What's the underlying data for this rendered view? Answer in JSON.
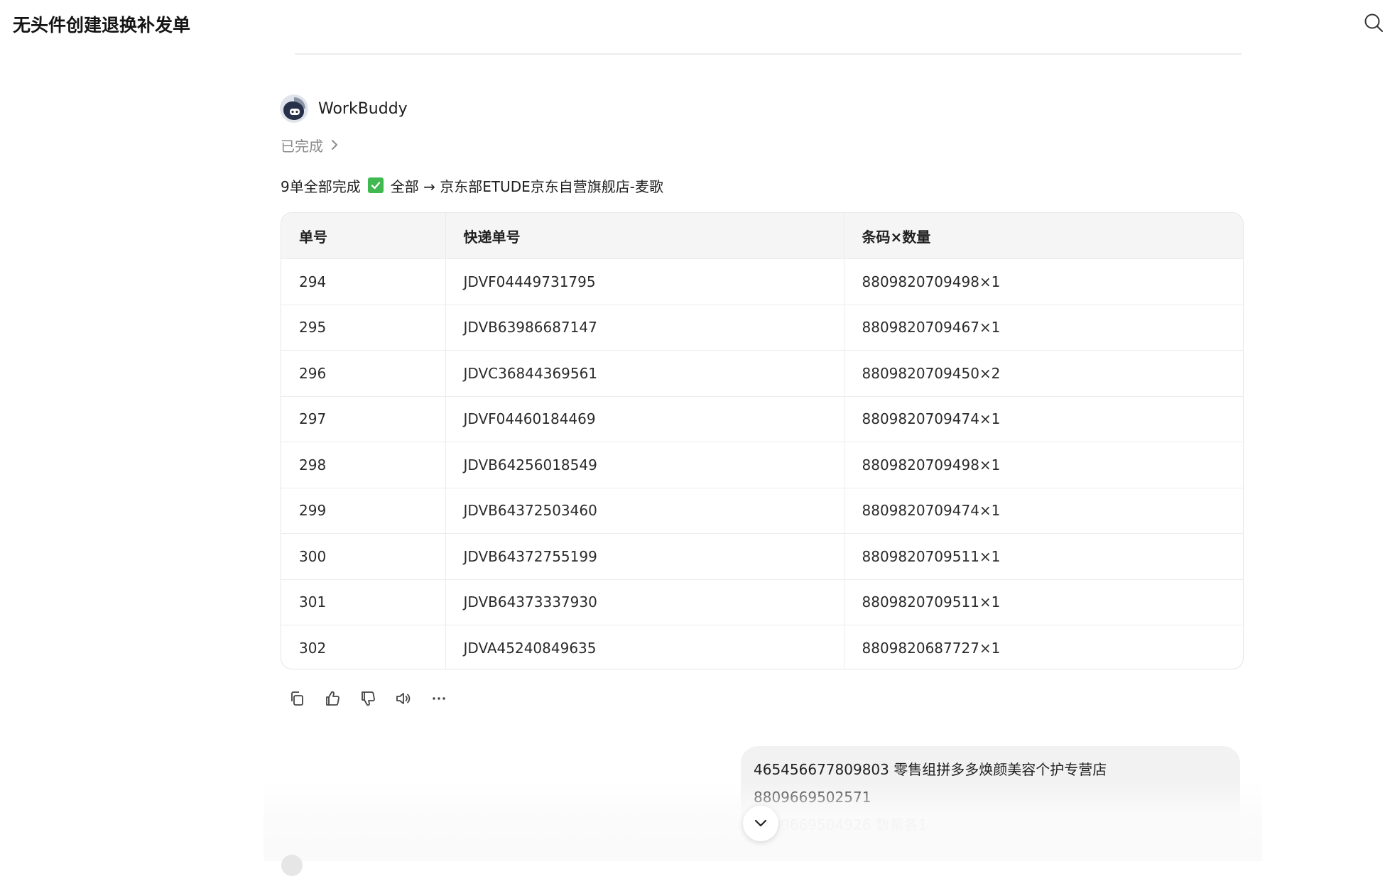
{
  "header": {
    "title": "无头件创建退换补发单"
  },
  "message": {
    "sender": "WorkBuddy",
    "status": "已完成",
    "summary_prefix": "9单全部完成",
    "summary_suffix": "全部 → 京东部ETUDE京东自营旗舰店-麦歌",
    "table": {
      "columns": [
        "单号",
        "快递单号",
        "条码×数量"
      ],
      "rows": [
        [
          "294",
          "JDVF04449731795",
          "8809820709498×1"
        ],
        [
          "295",
          "JDVB63986687147",
          "8809820709467×1"
        ],
        [
          "296",
          "JDVC36844369561",
          "8809820709450×2"
        ],
        [
          "297",
          "JDVF04460184469",
          "8809820709474×1"
        ],
        [
          "298",
          "JDVB64256018549",
          "8809820709498×1"
        ],
        [
          "299",
          "JDVB64372503460",
          "8809820709474×1"
        ],
        [
          "300",
          "JDVB64372755199",
          "8809820709511×1"
        ],
        [
          "301",
          "JDVB64373337930",
          "8809820709511×1"
        ],
        [
          "302",
          "JDVA45240849635",
          "8809820687727×1"
        ]
      ]
    },
    "actions": [
      "copy-icon",
      "thumbs-up-icon",
      "thumbs-down-icon",
      "speaker-icon",
      "more-icon"
    ]
  },
  "user_message": {
    "line1": "465456677809803 零售组拼多多焕颜美容个护专营店 8809669502571",
    "line2": "8809669504926  数量各1"
  },
  "colors": {
    "check_green": "#3fb950",
    "bubble_bg": "#f2f2f2",
    "table_header_bg": "#f5f5f5"
  }
}
